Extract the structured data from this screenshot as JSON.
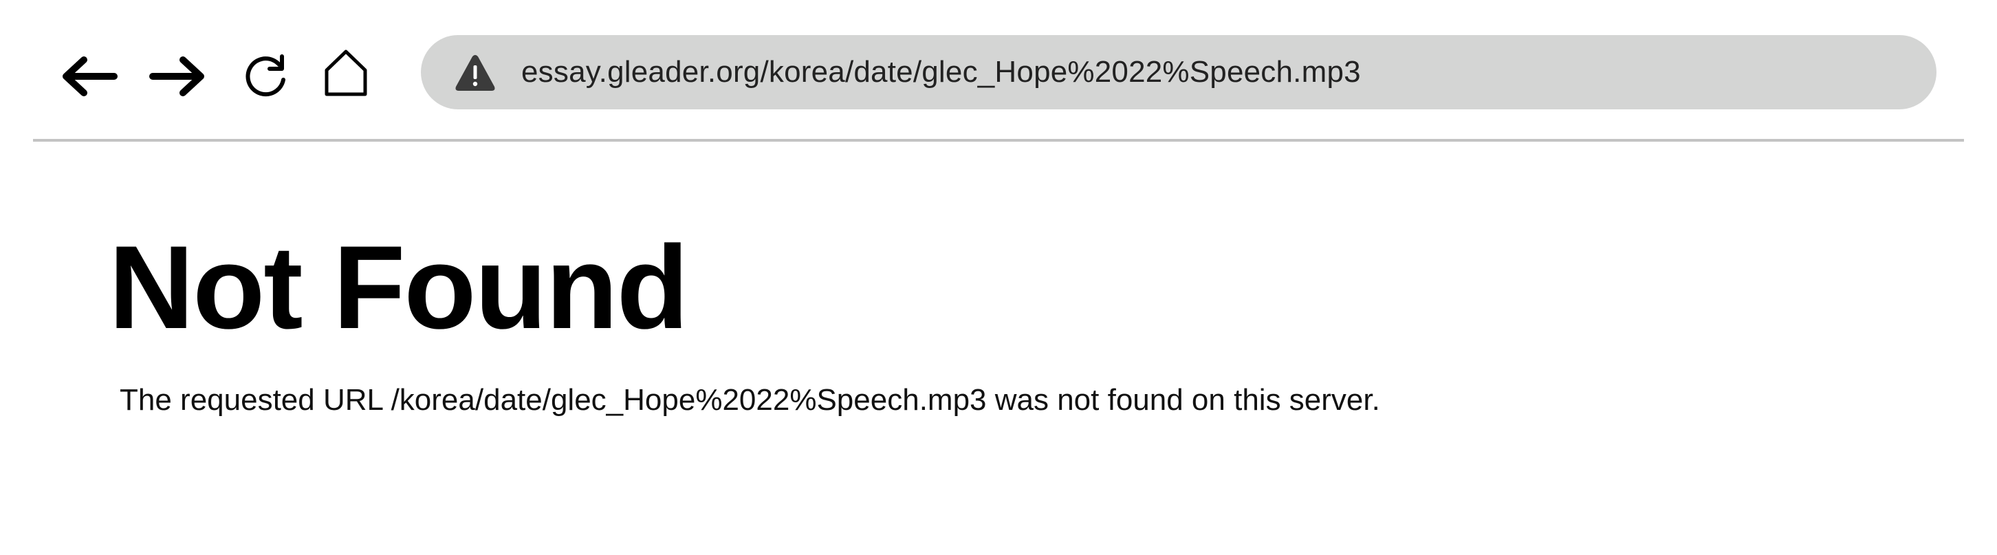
{
  "browser": {
    "back_icon": "back-arrow-icon",
    "forward_icon": "forward-arrow-icon",
    "reload_icon": "reload-icon",
    "home_icon": "home-icon",
    "security_icon": "warning-icon",
    "address_url": "essay.gleader.org/korea/date/glec_Hope%2022%Speech.mp3",
    "address_bar_color": "#d4d5d4"
  },
  "page": {
    "title": "Not Found",
    "message": "The requested URL /korea/date/glec_Hope%2022%Speech.mp3 was not found on this server."
  }
}
